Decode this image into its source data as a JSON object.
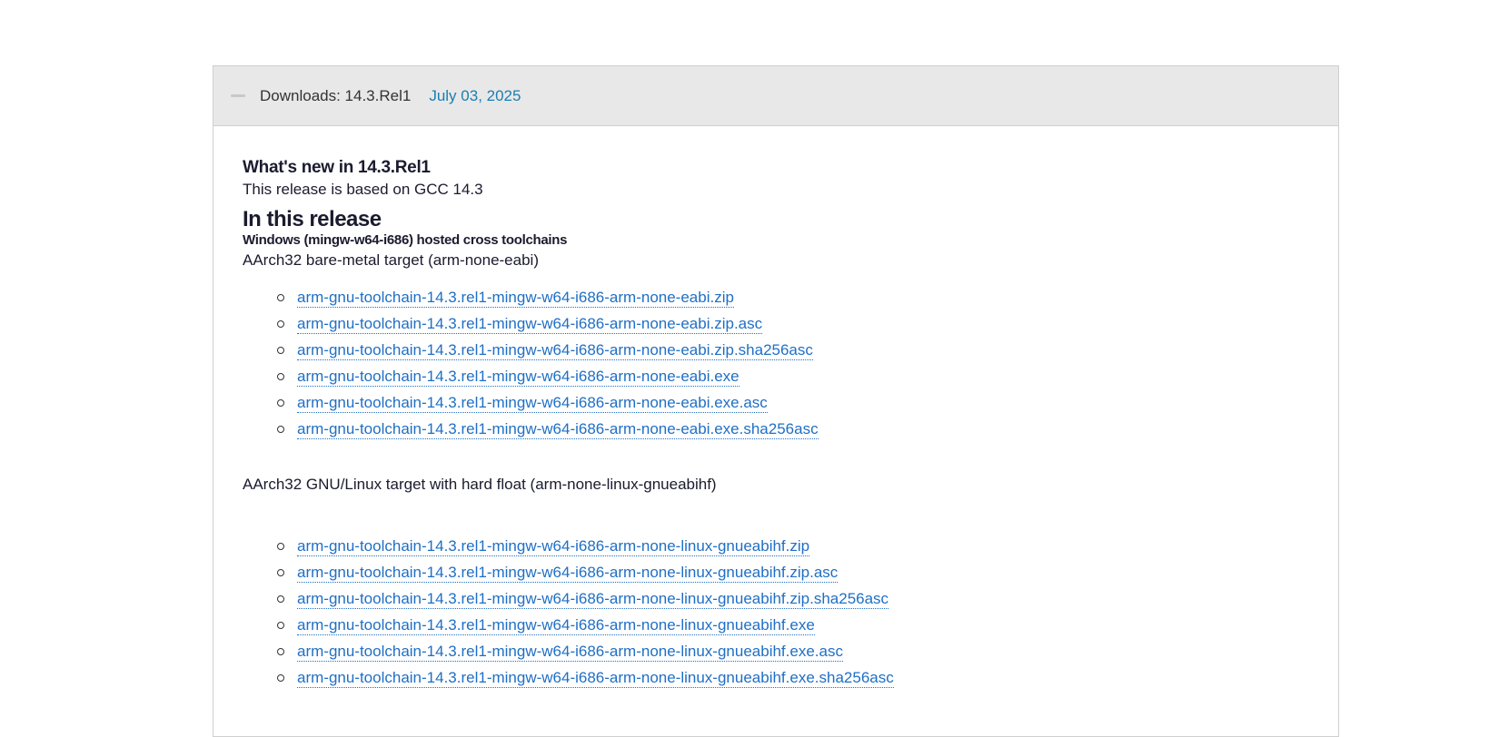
{
  "header": {
    "title": "Downloads: 14.3.Rel1",
    "date": "July 03, 2025",
    "toggle_icon": "collapse-minus-icon"
  },
  "content": {
    "whats_new": "What's new in 14.3.Rel1",
    "based_on": "This release is based on GCC 14.3",
    "in_release": "In this release",
    "hosted": "Windows (mingw-w64-i686) hosted cross toolchains",
    "sections": [
      {
        "label": "AArch32 bare-metal target (arm-none-eabi)",
        "links": [
          "arm-gnu-toolchain-14.3.rel1-mingw-w64-i686-arm-none-eabi.zip",
          "arm-gnu-toolchain-14.3.rel1-mingw-w64-i686-arm-none-eabi.zip.asc",
          "arm-gnu-toolchain-14.3.rel1-mingw-w64-i686-arm-none-eabi.zip.sha256asc",
          "arm-gnu-toolchain-14.3.rel1-mingw-w64-i686-arm-none-eabi.exe",
          "arm-gnu-toolchain-14.3.rel1-mingw-w64-i686-arm-none-eabi.exe.asc",
          "arm-gnu-toolchain-14.3.rel1-mingw-w64-i686-arm-none-eabi.exe.sha256asc"
        ]
      },
      {
        "label": "AArch32 GNU/Linux target with hard float (arm-none-linux-gnueabihf)",
        "links": [
          "arm-gnu-toolchain-14.3.rel1-mingw-w64-i686-arm-none-linux-gnueabihf.zip",
          "arm-gnu-toolchain-14.3.rel1-mingw-w64-i686-arm-none-linux-gnueabihf.zip.asc",
          "arm-gnu-toolchain-14.3.rel1-mingw-w64-i686-arm-none-linux-gnueabihf.zip.sha256asc",
          "arm-gnu-toolchain-14.3.rel1-mingw-w64-i686-arm-none-linux-gnueabihf.exe",
          "arm-gnu-toolchain-14.3.rel1-mingw-w64-i686-arm-none-linux-gnueabihf.exe.asc",
          "arm-gnu-toolchain-14.3.rel1-mingw-w64-i686-arm-none-linux-gnueabihf.exe.sha256asc"
        ]
      }
    ]
  }
}
